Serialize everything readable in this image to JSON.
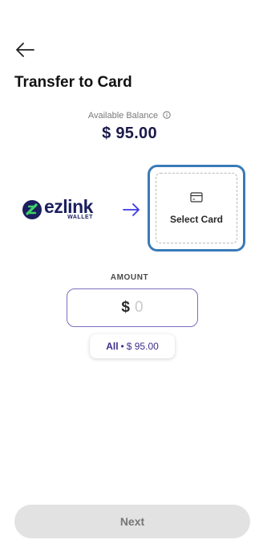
{
  "header": {
    "back_icon": "arrow-left-icon",
    "title": "Transfer to Card"
  },
  "balance": {
    "label": "Available Balance",
    "info_icon": "info-icon",
    "value": "$ 95.00"
  },
  "source": {
    "logo_word": "ezlink",
    "logo_sub": "WALLET",
    "arrow_icon": "arrow-right-icon"
  },
  "destination": {
    "card_icon": "card-icon",
    "label": "Select Card",
    "accent_color": "#3a7ab8"
  },
  "amount": {
    "label": "AMOUNT",
    "currency": "$",
    "placeholder": "0"
  },
  "all_chip": {
    "label": "All",
    "separator": "•",
    "amount": "$ 95.00"
  },
  "footer": {
    "next_label": "Next"
  }
}
